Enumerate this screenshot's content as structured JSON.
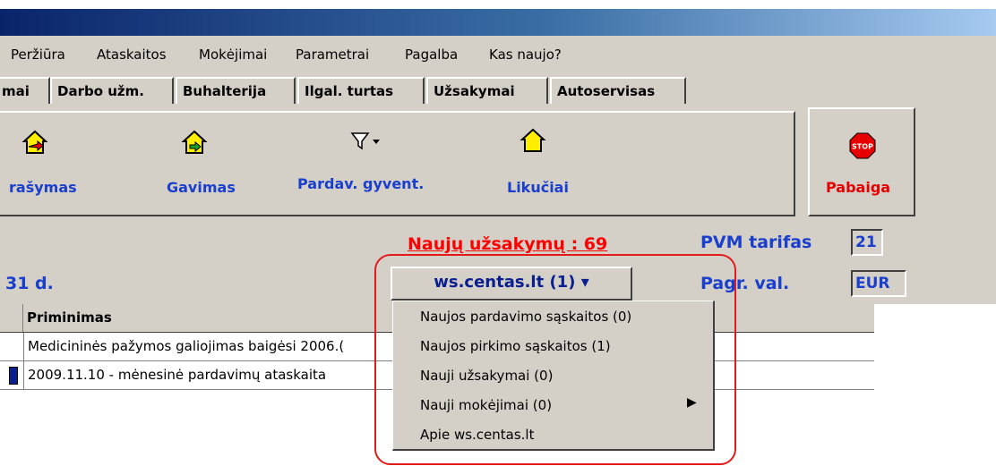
{
  "menubar": {
    "items": [
      "Peržiūra",
      "Ataskaitos",
      "Mokėjimai",
      "Parametrai",
      "Pagalba",
      "Kas naujo?"
    ]
  },
  "tabs": [
    "mai",
    "Darbo užm.",
    "Buhalterija",
    "Ilgal. turtas",
    "Užsakymai",
    "Autoservisas"
  ],
  "toolbar": {
    "buttons": [
      "rašymas",
      "Gavimas",
      "Pardav. gyvent.",
      "Likučiai"
    ],
    "stop_label": "Pabaiga",
    "stop_icon_text": "STOP"
  },
  "notice": "Naujų užsakymų : 69",
  "date_fragment": "31 d.",
  "vat": {
    "label": "PVM tarifas",
    "value": "21"
  },
  "currency": {
    "label": "Pagr. val.",
    "value": "EUR"
  },
  "ws_button": {
    "label": "ws.centas.lt (1)",
    "arrow": "▾"
  },
  "grid": {
    "header": "Priminimas",
    "rows": [
      "Medicininės pažymos galiojimas baigėsi 2006.(",
      "2009.11.10 - mėnesinė pardavimų ataskaita"
    ]
  },
  "dropdown_menu": [
    "Naujos pardavimo sąskaitos (0)",
    "Naujos pirkimo sąskaitos (1)",
    "Nauji užsakymai (0)",
    "Nauji mokėjimai (0)",
    "Apie ws.centas.lt"
  ],
  "colors": {
    "accent_blue": "#1a3fcc",
    "notice_red": "#ff0000",
    "face": "#d4d0c8",
    "highlight_outline": "#e21a1a"
  }
}
